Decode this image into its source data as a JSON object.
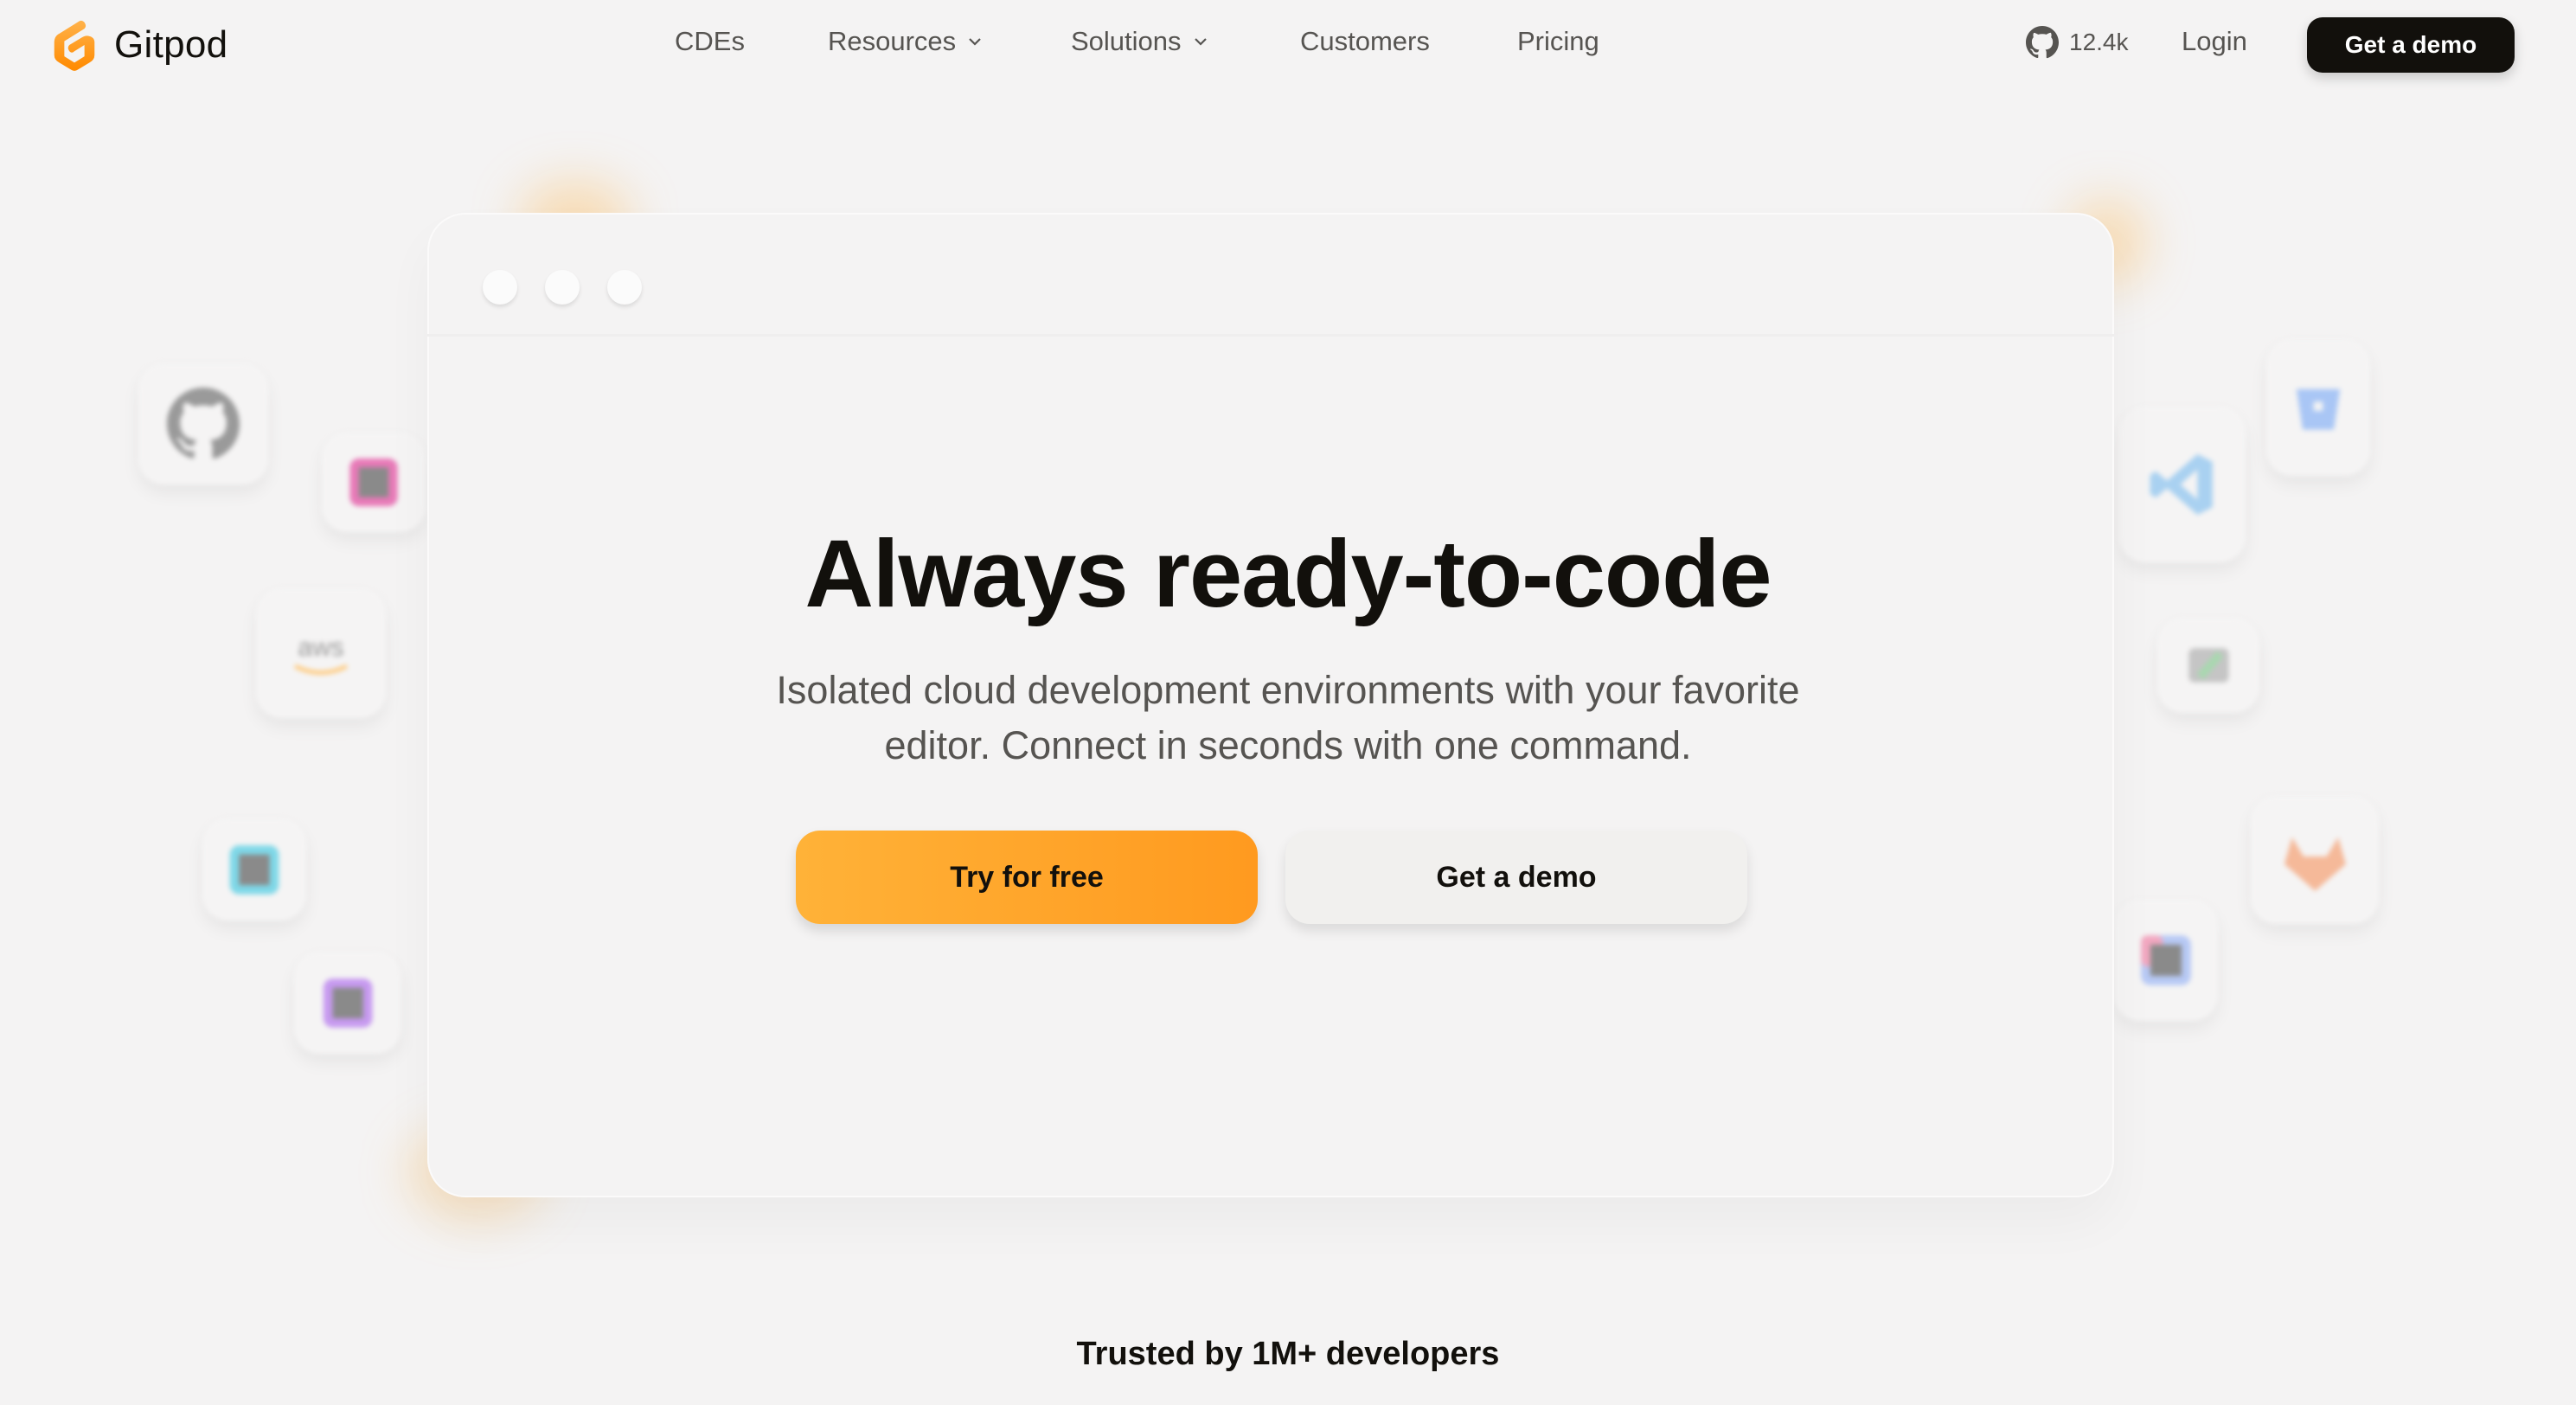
{
  "brand": {
    "name": "Gitpod",
    "accent": "#ff9a1f",
    "accent_light": "#ffb238"
  },
  "nav": {
    "items": [
      {
        "label": "CDEs",
        "has_dropdown": false
      },
      {
        "label": "Resources",
        "has_dropdown": true
      },
      {
        "label": "Solutions",
        "has_dropdown": true
      },
      {
        "label": "Customers",
        "has_dropdown": false
      },
      {
        "label": "Pricing",
        "has_dropdown": false
      }
    ],
    "github_stars": "12.4k",
    "login_label": "Login",
    "demo_label": "Get a demo"
  },
  "hero": {
    "headline": "Always ready-to-code",
    "subtitle_line1": "Isolated cloud development environments with your favorite",
    "subtitle_line2": "editor. Connect in seconds with one command.",
    "primary_cta": "Try for free",
    "secondary_cta": "Get a demo"
  },
  "floating_icons": {
    "left": [
      "github-icon",
      "rider-icon",
      "aws-icon",
      "webstorm-icon",
      "phpstorm-icon"
    ],
    "right": [
      "bitbucket-icon",
      "vscode-icon",
      "goland-icon",
      "gitlab-icon",
      "intellij-icon"
    ]
  },
  "social_proof": {
    "text": "Trusted by 1M+ developers"
  }
}
